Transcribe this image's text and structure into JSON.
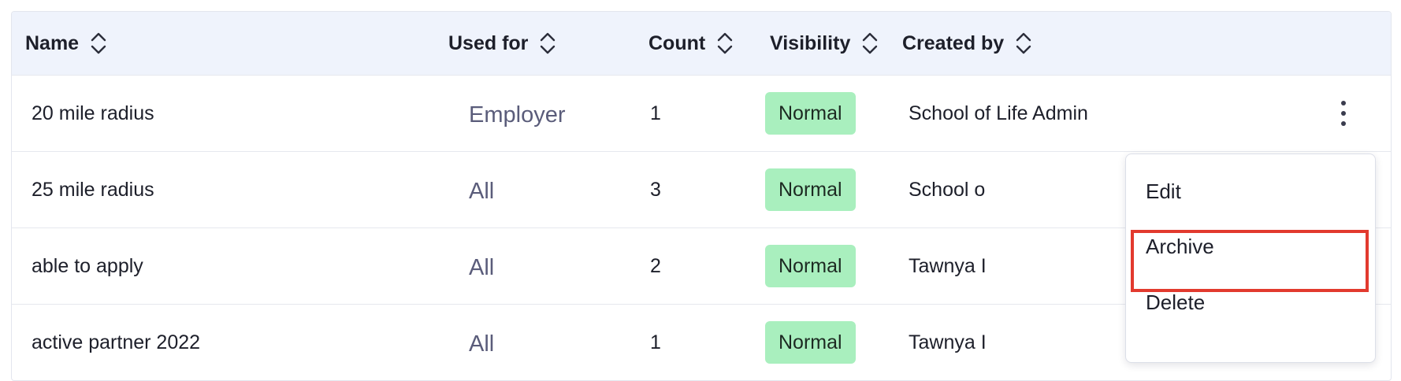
{
  "table": {
    "columns": [
      {
        "key": "name",
        "label": "Name"
      },
      {
        "key": "used_for",
        "label": "Used for"
      },
      {
        "key": "count",
        "label": "Count"
      },
      {
        "key": "visibility",
        "label": "Visibility"
      },
      {
        "key": "created_by",
        "label": "Created by"
      }
    ],
    "rows": [
      {
        "name": "20 mile radius",
        "used_for": "Employer",
        "count": "1",
        "visibility": "Normal",
        "created_by": "School of Life Admin"
      },
      {
        "name": "25 mile radius",
        "used_for": "All",
        "count": "3",
        "visibility": "Normal",
        "created_by": "School o"
      },
      {
        "name": "able to apply",
        "used_for": "All",
        "count": "2",
        "visibility": "Normal",
        "created_by": "Tawnya I"
      },
      {
        "name": "active partner 2022",
        "used_for": "All",
        "count": "1",
        "visibility": "Normal",
        "created_by": "Tawnya I"
      }
    ]
  },
  "row_menu": {
    "items": [
      "Edit",
      "Archive",
      "Delete"
    ],
    "highlighted": "Archive"
  },
  "colors": {
    "header_bg": "#eff3fc",
    "badge_bg": "#a9efbe",
    "used_for_text": "#5a5c7a",
    "highlight_border": "#e23a2e"
  }
}
